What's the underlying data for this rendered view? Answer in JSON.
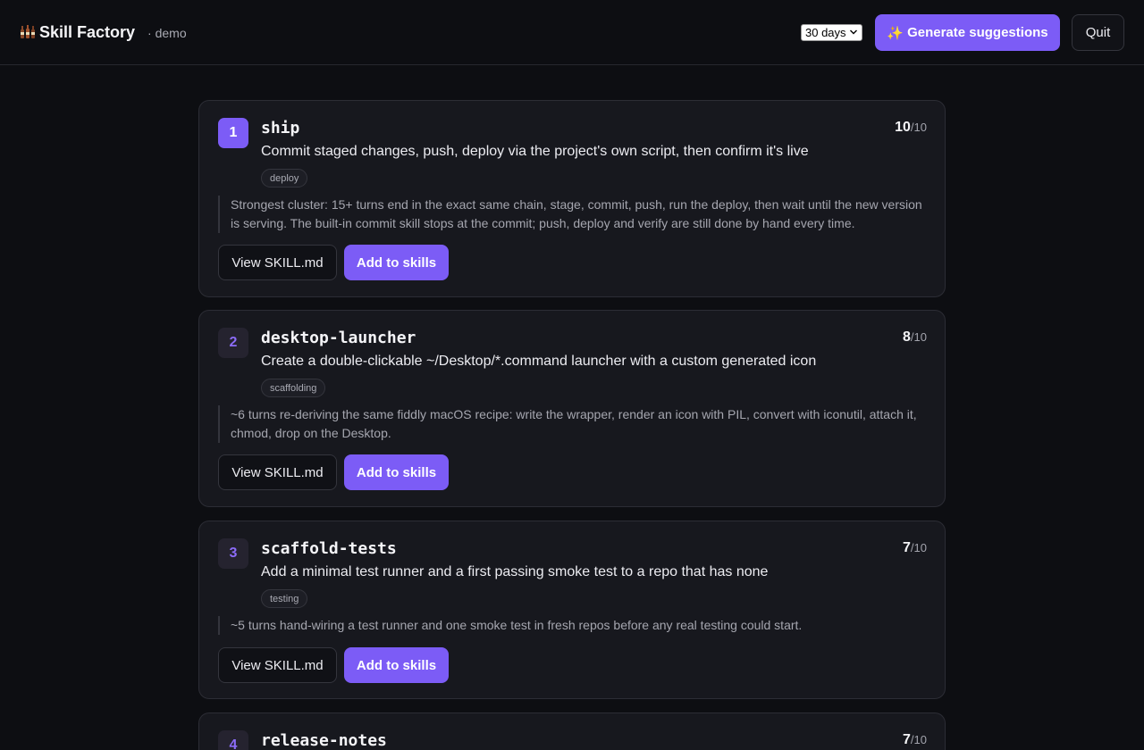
{
  "app": {
    "title": "Skill Factory",
    "subtitle": "· demo",
    "logo_icon": "bottles-icon"
  },
  "toolbar": {
    "period_value": "30 days",
    "generate_icon": "sparkles-icon",
    "generate_label": "Generate suggestions",
    "quit_label": "Quit"
  },
  "colors": {
    "accent": "#7c5cf6",
    "background": "#0d0e12",
    "card": "#17181e"
  },
  "suggestions": [
    {
      "rank": "1",
      "name": "ship",
      "score": "10",
      "score_max": "/10",
      "description": "Commit staged changes, push, deploy via the project's own script, then confirm it's live",
      "tag": "deploy",
      "reason": "Strongest cluster: 15+ turns end in the exact same chain, stage, commit, push, run the deploy, then wait until the new version is serving. The built-in commit skill stops at the commit; push, deploy and verify are still done by hand every time.",
      "view_label": "View SKILL.md",
      "add_label": "Add to skills"
    },
    {
      "rank": "2",
      "name": "desktop-launcher",
      "score": "8",
      "score_max": "/10",
      "description": "Create a double-clickable ~/Desktop/*.command launcher with a custom generated icon",
      "tag": "scaffolding",
      "reason": "~6 turns re-deriving the same fiddly macOS recipe: write the wrapper, render an icon with PIL, convert with iconutil, attach it, chmod, drop on the Desktop.",
      "view_label": "View SKILL.md",
      "add_label": "Add to skills"
    },
    {
      "rank": "3",
      "name": "scaffold-tests",
      "score": "7",
      "score_max": "/10",
      "description": "Add a minimal test runner and a first passing smoke test to a repo that has none",
      "tag": "testing",
      "reason": "~5 turns hand-wiring a test runner and one smoke test in fresh repos before any real testing could start.",
      "view_label": "View SKILL.md",
      "add_label": "Add to skills"
    },
    {
      "rank": "4",
      "name": "release-notes",
      "score": "7",
      "score_max": "/10"
    }
  ]
}
